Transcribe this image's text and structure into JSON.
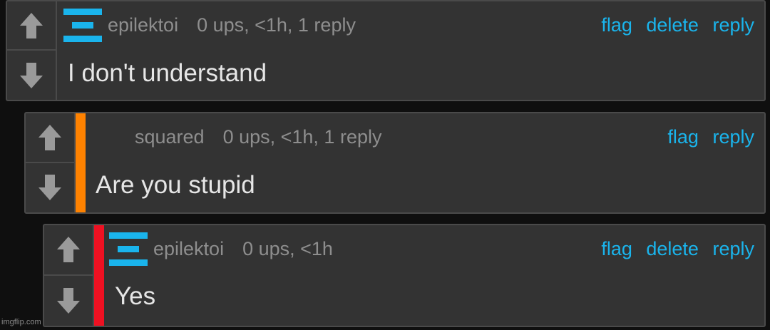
{
  "comments": [
    {
      "username": "epilektoi",
      "stats": "0 ups, <1h, 1 reply",
      "actions": [
        "flag",
        "delete",
        "reply"
      ],
      "text": "I don't understand",
      "depth_color": null,
      "has_badge": true
    },
    {
      "username": "squared",
      "stats": "0 ups, <1h, 1 reply",
      "actions": [
        "flag",
        "reply"
      ],
      "text": "Are you stupid",
      "depth_color": "#ff8200",
      "has_badge": false
    },
    {
      "username": "epilektoi",
      "stats": "0 ups, <1h",
      "actions": [
        "flag",
        "delete",
        "reply"
      ],
      "text": "Yes",
      "depth_color": "#ee1122",
      "has_badge": true
    }
  ],
  "colors": {
    "link": "#1ab4ec",
    "badge": "#1ab4ec",
    "card_bg": "#333333",
    "page_bg": "#0f0f0f"
  },
  "icons": {
    "upvote": "arrow-up-icon",
    "downvote": "arrow-down-icon",
    "badge": "user-badge-icon"
  },
  "watermark": "imgflip.com"
}
